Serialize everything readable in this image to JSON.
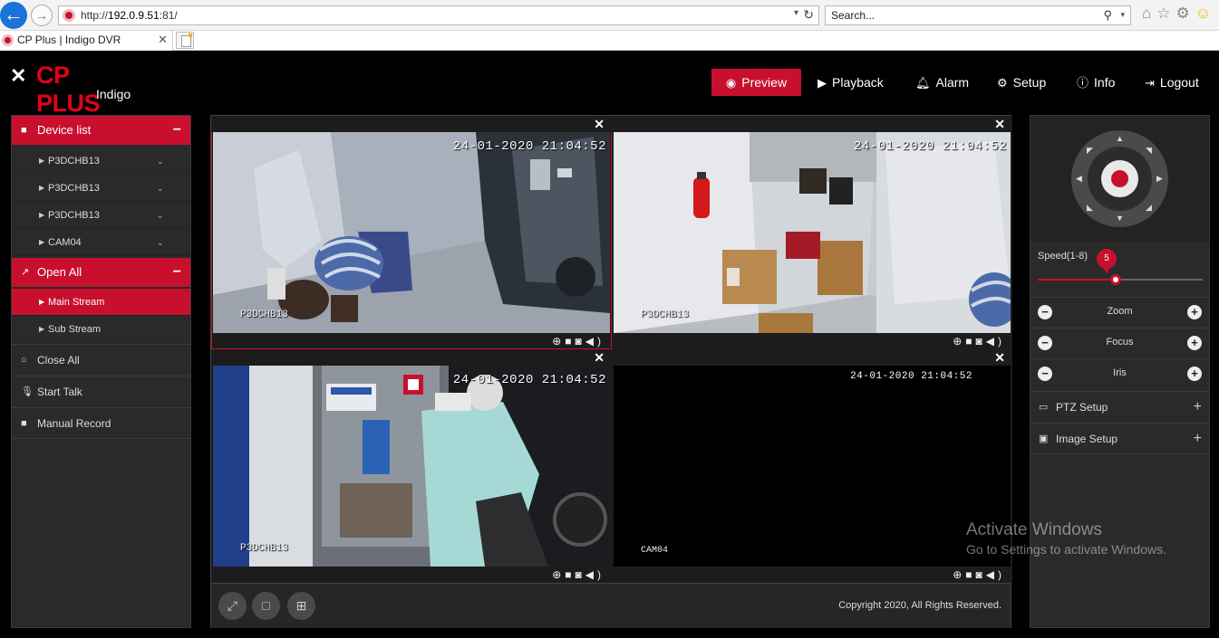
{
  "browser": {
    "url_prefix": "http://",
    "url_host": "192.0.9.51",
    "url_suffix": ":81/",
    "search_placeholder": "Search...",
    "tab_title": "CP Plus | Indigo DVR",
    "tab_close": "✕"
  },
  "app": {
    "brand": "CP PLUS",
    "sub_brand": "Indigo",
    "nav": {
      "preview": "Preview",
      "playback": "Playback",
      "alarm": "Alarm",
      "setup": "Setup",
      "info": "Info",
      "logout": "Logout"
    }
  },
  "left_panel": {
    "device_list_label": "Device list",
    "devices": [
      "P3DCHB13",
      "P3DCHB13",
      "P3DCHB13",
      "CAM04"
    ],
    "open_all_label": "Open All",
    "streams": [
      "Main Stream",
      "Sub Stream"
    ],
    "active_stream": "Main Stream",
    "close_all_label": "Close All",
    "start_talk_label": "Start Talk",
    "manual_record_label": "Manual Record"
  },
  "cameras": [
    {
      "timestamp": "24-01-2020 21:04:52",
      "label": "P3DCHB13",
      "selected": true
    },
    {
      "timestamp": "24-01-2020 21:04:52",
      "label": "P3DCHB13",
      "selected": false
    },
    {
      "timestamp": "24-01-2020 21:04:52",
      "label": "P3DCHB13",
      "selected": false
    },
    {
      "timestamp": "24-01-2020 21:04:52",
      "label": "CAM04",
      "selected": false
    }
  ],
  "grid_footer": {
    "copyright": "Copyright 2020, All Rights Reserved."
  },
  "ptz": {
    "speed_label": "Speed(1-8)",
    "speed_value": "5",
    "speed_min": 1,
    "speed_max": 8,
    "zoom_label": "Zoom",
    "focus_label": "Focus",
    "iris_label": "Iris",
    "ptz_setup_label": "PTZ Setup",
    "image_setup_label": "Image Setup"
  },
  "watermark": {
    "line1": "Activate Windows",
    "line2": "Go to Settings to activate Windows."
  },
  "colors": {
    "accent": "#c8102e",
    "panel": "#2a2a2a",
    "background": "#000000"
  }
}
